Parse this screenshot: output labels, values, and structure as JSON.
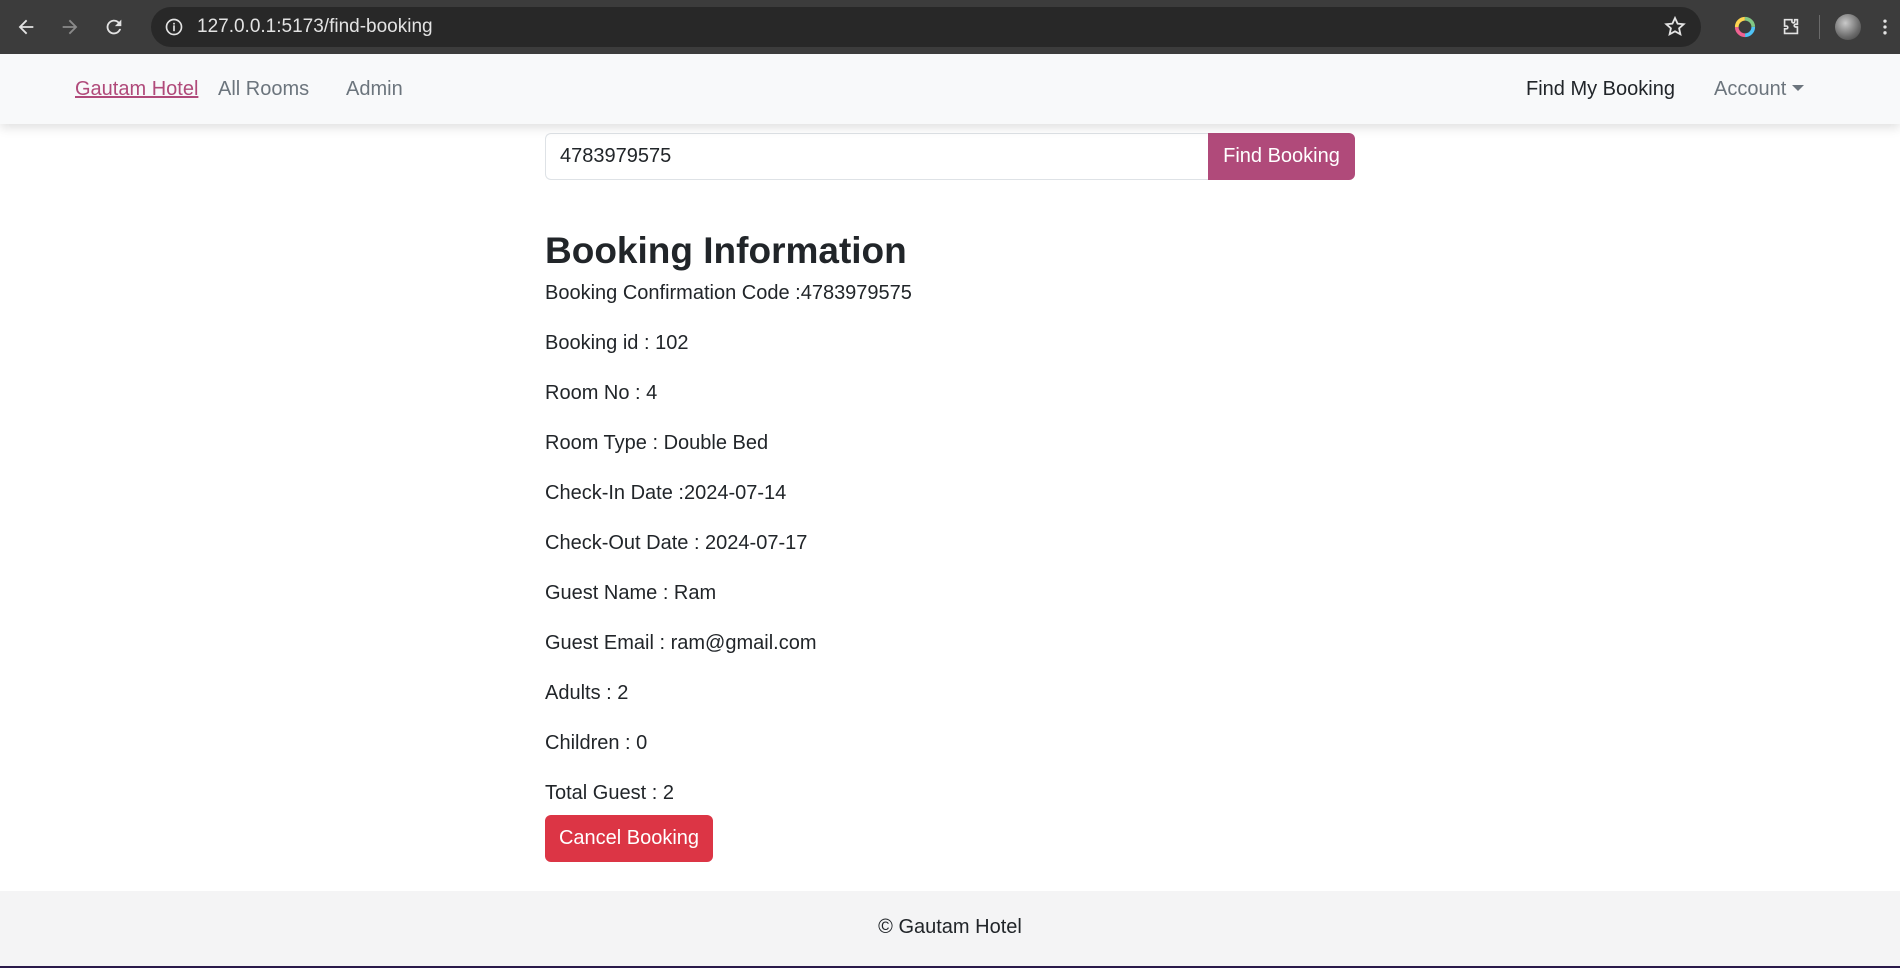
{
  "browser": {
    "url": "127.0.0.1:5173/find-booking"
  },
  "navbar": {
    "brand": "Gautam Hotel",
    "links": [
      "All Rooms",
      "Admin"
    ],
    "right_links": [
      "Find My Booking",
      "Account"
    ]
  },
  "search": {
    "value": "4783979575",
    "button_label": "Find Booking"
  },
  "booking": {
    "heading": "Booking Information",
    "lines": [
      "Booking Confirmation Code :4783979575",
      "Booking id : 102",
      "Room No : 4",
      "Room Type : Double Bed",
      "Check-In Date :2024-07-14",
      "Check-Out Date : 2024-07-17",
      "Guest Name : Ram",
      "Guest Email : ram@gmail.com",
      "Adults : 2",
      "Children : 0",
      "Total Guest : 2"
    ],
    "cancel_label": "Cancel Booking"
  },
  "footer": {
    "text": "© Gautam Hotel"
  },
  "colors": {
    "brand": "#b04a7a",
    "danger": "#dc3545"
  }
}
